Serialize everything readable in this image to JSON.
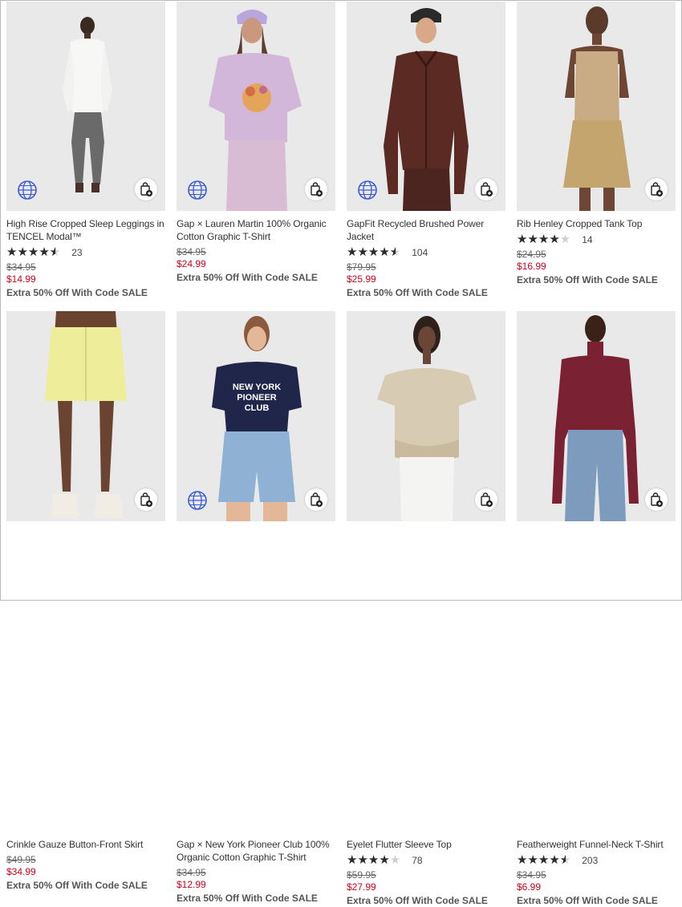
{
  "products": [
    {
      "name": "High Rise Cropped Sleep Leggings in TENCEL Modal™",
      "rating": 4.5,
      "reviews": "23",
      "original_price": "$34.95",
      "sale_price": "$14.99",
      "promo": "Extra 50% Off With Code SALE",
      "has_eco_badge": true
    },
    {
      "name": "Gap × Lauren Martin 100% Organic Cotton Graphic T-Shirt",
      "rating": null,
      "reviews": "",
      "original_price": "$34.95",
      "sale_price": "$24.99",
      "promo": "Extra 50% Off With Code SALE",
      "has_eco_badge": true
    },
    {
      "name": "GapFit Recycled Brushed Power Jacket",
      "rating": 4.5,
      "reviews": "104",
      "original_price": "$79.95",
      "sale_price": "$25.99",
      "promo": "Extra 50% Off With Code SALE",
      "has_eco_badge": true
    },
    {
      "name": "Rib Henley Cropped Tank Top",
      "rating": 4,
      "reviews": "14",
      "original_price": "$24.95",
      "sale_price": "$16.99",
      "promo": "Extra 50% Off With Code SALE",
      "has_eco_badge": false
    },
    {
      "name": "Crinkle Gauze Button-Front Skirt",
      "rating": null,
      "reviews": "",
      "original_price": "$49.95",
      "sale_price": "$34.99",
      "promo": "Extra 50% Off With Code SALE",
      "has_eco_badge": false
    },
    {
      "name": "Gap × New York Pioneer Club 100% Organic Cotton Graphic T-Shirt",
      "rating": null,
      "reviews": "",
      "original_price": "$34.95",
      "sale_price": "$12.99",
      "promo": "Extra 50% Off With Code SALE",
      "has_eco_badge": true,
      "shirt_print": "NEW YORK PIONEER CLUB"
    },
    {
      "name": "Eyelet Flutter Sleeve Top",
      "rating": 4,
      "reviews": "78",
      "original_price": "$59.95",
      "sale_price": "$27.99",
      "promo": "Extra 50% Off With Code SALE",
      "has_eco_badge": false
    },
    {
      "name": "Featherweight Funnel-Neck T-Shirt",
      "rating": 4.5,
      "reviews": "203",
      "original_price": "$34.95",
      "sale_price": "$6.99",
      "promo": "Extra 50% Off With Code SALE",
      "has_eco_badge": false
    }
  ],
  "colors": {
    "sale_price": "#d0021b",
    "image_bg": "#e9e9e9",
    "star_filled": "#2b2b2b",
    "star_empty": "#cfcfcf",
    "eco_badge": "#3b5bd6"
  },
  "icons": {
    "quick_add": "bag-plus-icon",
    "eco_badge": "globe-icon",
    "rating": "star-icon"
  }
}
